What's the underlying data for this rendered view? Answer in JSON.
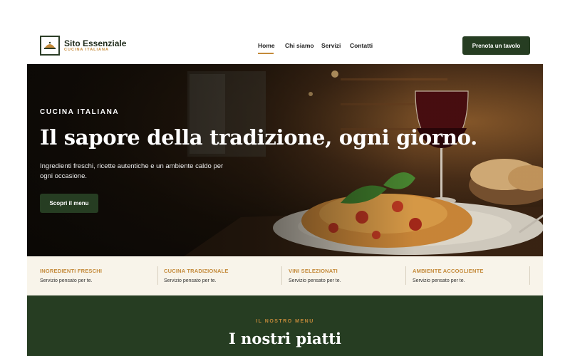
{
  "brand": {
    "name": "Sito Essenziale",
    "tagline": "CUCINA ITALIANA",
    "logo_icon": "dish-cloche-icon"
  },
  "nav": {
    "items": [
      {
        "label": "Home",
        "active": true
      },
      {
        "label": "Chi siamo",
        "active": false
      },
      {
        "label": "Servizi",
        "active": false
      },
      {
        "label": "Contatti",
        "active": false
      }
    ],
    "cta_label": "Prenota un tavolo"
  },
  "hero": {
    "kicker": "CUCINA ITALIANA",
    "title": "Il sapore della tradizione, ogni giorno.",
    "subtitle": "Ingredienti freschi, ricette autentiche e un ambiente caldo per ogni occasione.",
    "button_label": "Scopri il menu"
  },
  "features": [
    {
      "title": "INGREDIENTI FRESCHI",
      "desc": "Servizio pensato per te."
    },
    {
      "title": "CUCINA TRADIZIONALE",
      "desc": "Servizio pensato per te."
    },
    {
      "title": "VINI SELEZIONATI",
      "desc": "Servizio pensato per te."
    },
    {
      "title": "AMBIENTE ACCOGLIENTE",
      "desc": "Servizio pensato per te."
    }
  ],
  "menu_section": {
    "kicker": "IL NOSTRO MENU",
    "title": "I nostri piatti"
  },
  "colors": {
    "brand_green": "#263d22",
    "accent_gold": "#c48a3a",
    "feature_bg": "#f8f4ea"
  }
}
